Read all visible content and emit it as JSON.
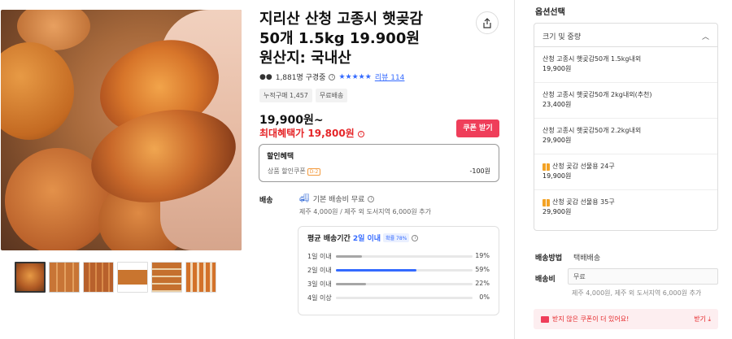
{
  "product": {
    "title": "지리산 산청 고종시 햇곶감\n50개 1.5kg 19.900원\n원산지: 국내산",
    "rating_count": "1,881명 구경중",
    "stars": "★★★★★",
    "review_link": "리뷰 114",
    "badges": [
      "누적구매 1,457",
      "무료배송"
    ],
    "price": "19,900원~",
    "best_price": "최대혜택가 19,800원",
    "coupon_button": "쿠폰 받기",
    "info_icon": "i"
  },
  "discount": {
    "title": "할인혜택",
    "label": "상품 할인쿠폰",
    "code": "D-2",
    "amount": "-100원"
  },
  "shipping": {
    "label": "배송",
    "free": "기본 배송비 무료",
    "extra": "제주 4,000원 / 제주 외 도서지역 6,000원 추가"
  },
  "delivery_stats": {
    "heading_prefix": "평균 배송기간",
    "heading_highlight": "2일 이내",
    "rate_badge": "확률 78%",
    "rows": [
      {
        "label": "1일 이내",
        "pct": "19%",
        "value": 0.19,
        "highlight": false
      },
      {
        "label": "2일 이내",
        "pct": "59%",
        "value": 0.59,
        "highlight": true
      },
      {
        "label": "3일 이내",
        "pct": "22%",
        "value": 0.22,
        "highlight": false
      },
      {
        "label": "4일 이상",
        "pct": "0%",
        "value": 0.0,
        "highlight": false
      }
    ]
  },
  "options": {
    "title": "옵션선택",
    "group_label": "크기 및 중량",
    "items": [
      {
        "name": "산청 고종시 햇곶감50개 1.5kg내외",
        "price": "19,900원"
      },
      {
        "name": "산청 고종시 햇곶감50개 2kg내외(추천)",
        "price": "23,400원"
      },
      {
        "name": "산청 고종시 햇곶감50개 2.2kg내외",
        "price": "29,900원"
      },
      {
        "name": "산청 곶감 선물용 24구",
        "price": "19,900원"
      },
      {
        "name": "산청 곶감 선물용 35구",
        "price": "29,900원"
      }
    ]
  },
  "right_shipping": {
    "method_label": "배송방법",
    "method_value": "택배배송",
    "fee_label": "배송비",
    "fee_value": "무료",
    "fee_note": "제주 4,000원, 제주 외 도서지역 6,000원 추가"
  },
  "coupon_banner": {
    "text": "받지 않은 쿠폰이 더 있어요!",
    "download": "받기 ⤓"
  },
  "icons": {
    "share": "share-icon",
    "truck": "truck-icon",
    "chevron": "chevron-up-icon",
    "gift": "gift-icon",
    "coupon": "coupon-icon"
  },
  "colors": {
    "accent_blue": "#346aff",
    "sale_red": "#e52528",
    "coupon_pink": "#ef3e5a"
  }
}
